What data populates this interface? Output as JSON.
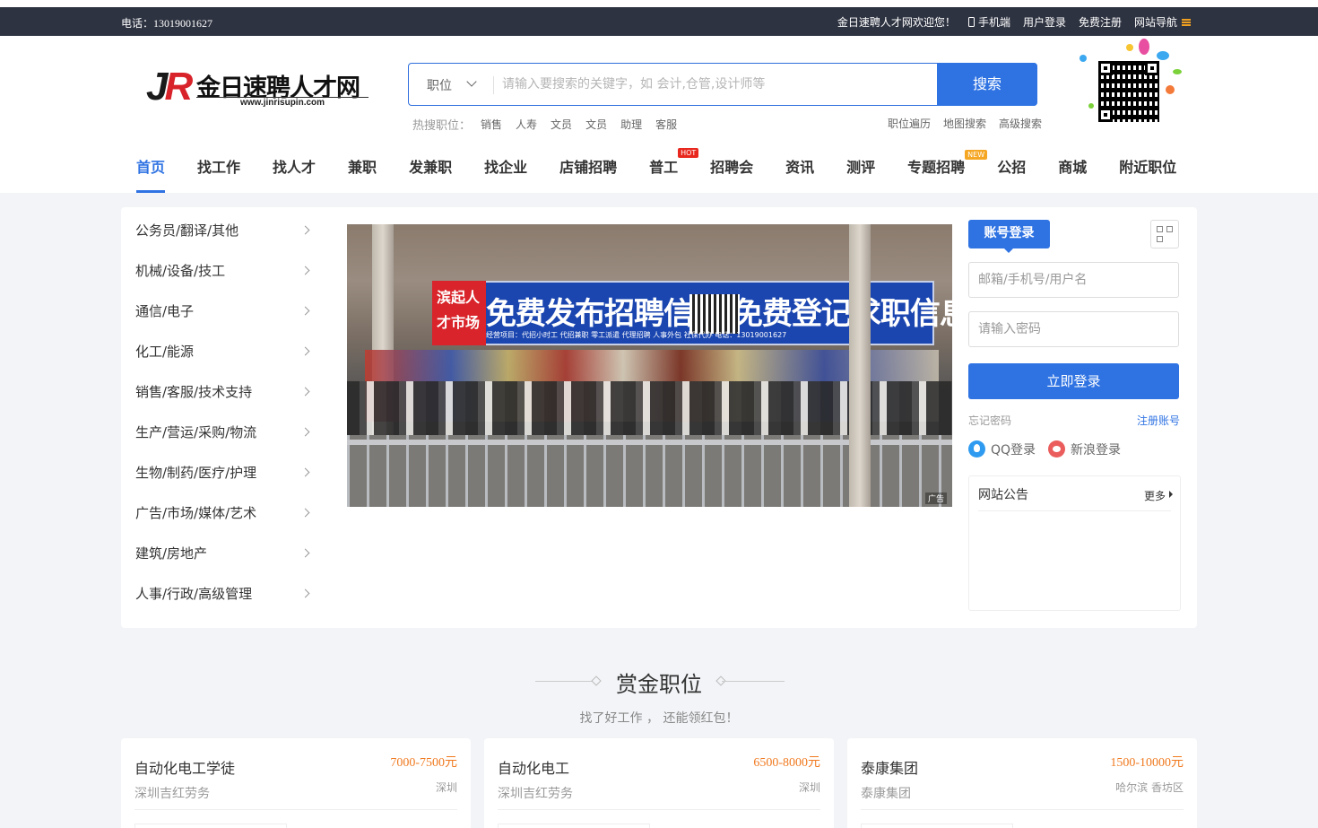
{
  "topbar": {
    "phone": "电话：13019001627",
    "welcome": "金日速聘人才网欢迎您！",
    "mobile": "手机端",
    "login": "用户登录",
    "register": "免费注册",
    "sitenav": "网站导航"
  },
  "logo": {
    "mark_j": "J",
    "mark_r": "R",
    "name": "金日速聘人才网",
    "url": "www.jinrisupin.com"
  },
  "search": {
    "category": "职位",
    "placeholder": "请输入要搜索的关键字，如 会计,仓管,设计师等",
    "button": "搜索"
  },
  "hot": {
    "label": "热搜职位：",
    "keywords": [
      "销售",
      "人寿",
      "文员",
      "文员",
      "助理",
      "客服"
    ]
  },
  "extra_links": [
    "职位遍历",
    "地图搜索",
    "高级搜索"
  ],
  "nav": {
    "items": [
      "首页",
      "找工作",
      "找人才",
      "兼职",
      "发兼职",
      "找企业",
      "店铺招聘",
      "普工",
      "招聘会",
      "资讯",
      "测评",
      "专题招聘",
      "公招",
      "商城",
      "附近职位"
    ],
    "hot_badge": "HOT",
    "new_badge": "NEW"
  },
  "categories": [
    "公务员/翻译/其他",
    "机械/设备/技工",
    "通信/电子",
    "化工/能源",
    "销售/客服/技术支持",
    "生产/营运/采购/物流",
    "生物/制药/医疗/护理",
    "广告/市场/媒体/艺术",
    "建筑/房地产",
    "人事/行政/高级管理"
  ],
  "banner": {
    "red_text": "滨起人才市场",
    "sign_text": "免费发布招聘信息 免费登记求职信息",
    "sub_text": "经营项目：代招小时工 代招兼职 零工派遣 代理招聘 人事外包 社保代办   电话：13019001627",
    "ad": "广告"
  },
  "login": {
    "tab": "账号登录",
    "user_placeholder": "邮箱/手机号/用户名",
    "pass_placeholder": "请输入密码",
    "submit": "立即登录",
    "forget": "忘记密码",
    "register": "注册账号",
    "qq": "QQ登录",
    "weibo": "新浪登录"
  },
  "notice": {
    "title": "网站公告",
    "more": "更多"
  },
  "bounty": {
    "title": "赏金职位",
    "subtitle": "找了好工作 ， 还能领红包！"
  },
  "jobs": [
    {
      "name": "自动化电工学徒",
      "salary": "7000-7500元",
      "company": "深圳吉红劳务",
      "location": "深圳"
    },
    {
      "name": "自动化电工",
      "salary": "6500-8000元",
      "company": "深圳吉红劳务",
      "location": "深圳"
    },
    {
      "name": "泰康集团",
      "salary": "1500-10000元",
      "company": "泰康集团",
      "location": "哈尔滨 香坊区"
    }
  ],
  "colors": {
    "accent": "#2f73e3",
    "topbar": "#2e3341",
    "salary": "#f07a20",
    "hot_badge": "#e8281e",
    "new_badge": "#f5a623"
  }
}
